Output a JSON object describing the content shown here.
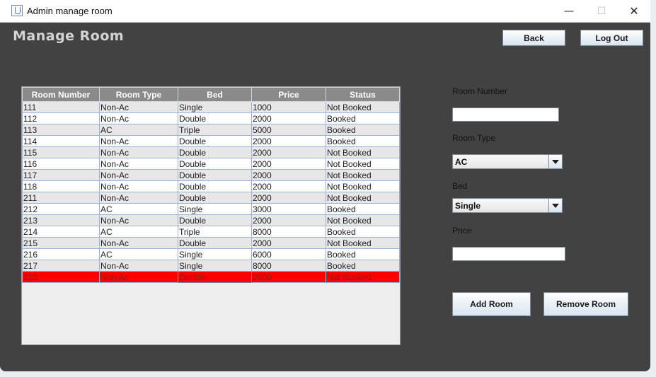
{
  "window": {
    "title": "Admin manage room",
    "minimize": "—",
    "maximize": "☐",
    "close": "✕"
  },
  "header": {
    "page_title": "Manage Room",
    "back_label": "Back",
    "logout_label": "Log Out"
  },
  "table": {
    "columns": [
      "Room Number",
      "Room Type",
      "Bed",
      "Price",
      "Status"
    ],
    "rows": [
      [
        "111",
        "Non-Ac",
        "Single",
        "1000",
        "Not Booked"
      ],
      [
        "112",
        "Non-Ac",
        "Double",
        "2000",
        "Booked"
      ],
      [
        "113",
        "AC",
        "Triple",
        "5000",
        "Booked"
      ],
      [
        "114",
        "Non-Ac",
        "Double",
        "2000",
        "Booked"
      ],
      [
        "115",
        "Non-Ac",
        "Double",
        "2000",
        "Not Booked"
      ],
      [
        "116",
        "Non-Ac",
        "Double",
        "2000",
        "Not Booked"
      ],
      [
        "117",
        "Non-Ac",
        "Double",
        "2000",
        "Not Booked"
      ],
      [
        "118",
        "Non-Ac",
        "Double",
        "2000",
        "Not Booked"
      ],
      [
        "211",
        "Non-Ac",
        "Double",
        "2000",
        "Not Booked"
      ],
      [
        "212",
        "AC",
        "Single",
        "3000",
        "Booked"
      ],
      [
        "213",
        "Non-Ac",
        "Double",
        "2000",
        "Not Booked"
      ],
      [
        "214",
        "AC",
        "Triple",
        "8000",
        "Booked"
      ],
      [
        "215",
        "Non-Ac",
        "Double",
        "2000",
        "Not Booked"
      ],
      [
        "216",
        "AC",
        "Single",
        "6000",
        "Booked"
      ],
      [
        "217",
        "Non-Ac",
        "Single",
        "8000",
        "Booked"
      ],
      [
        "218",
        "Non-Ac",
        "Double",
        "2000",
        "Not Booked"
      ]
    ],
    "selected_row": "218"
  },
  "form": {
    "room_number_label": "Room Number",
    "room_number_value": "",
    "room_type_label": "Room Type",
    "room_type_value": "AC",
    "bed_label": "Bed",
    "bed_value": "Single",
    "price_label": "Price",
    "price_value": "",
    "add_label": "Add Room",
    "remove_label": "Remove Room"
  },
  "colors": {
    "background": "#424242",
    "selected_row": "#ff0000",
    "header_bg": "#8a8a8a"
  }
}
